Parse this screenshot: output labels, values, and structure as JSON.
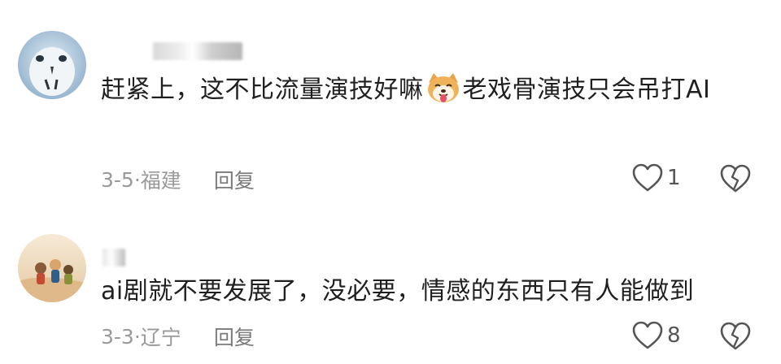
{
  "comments": [
    {
      "text_before_emoji": "赶紧上，这不比流量演技好嘛",
      "emoji": "dog-face-emoji",
      "text_after_emoji": "老戏骨演技只会吊打AI",
      "date": "3-5",
      "location": "福建",
      "reply_label": "回复",
      "like_count": "1"
    },
    {
      "text": "ai剧就不要发展了，没必要，情感的东西只有人能做到",
      "date": "3-3",
      "location": "辽宁",
      "reply_label": "回复",
      "like_count": "8"
    }
  ],
  "meta_separator": "·",
  "icons": {
    "like": "heart-outline-icon",
    "dislike": "broken-heart-icon"
  },
  "colors": {
    "text": "#1f1f1f",
    "meta": "#9a9a9a",
    "icon": "#555555"
  }
}
